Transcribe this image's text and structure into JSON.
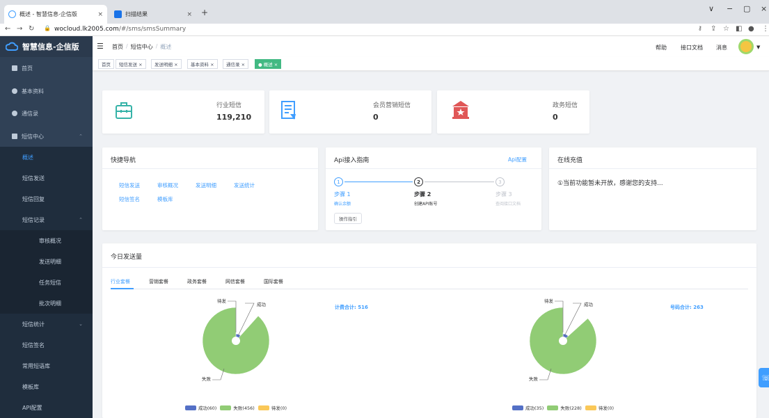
{
  "browser": {
    "tabs": [
      {
        "title": "概述 - 智慧信息-企信版",
        "close": "×"
      },
      {
        "title": "扫描结果",
        "close": "×"
      }
    ],
    "new_tab": "+",
    "url_host": "wocloud.lk2005.com",
    "url_path": "/#/sms/smsSummary",
    "window_controls": [
      "∨",
      "−",
      "▢",
      "×"
    ]
  },
  "brand": {
    "name": "智慧信息-企信版",
    "color": "#409eff"
  },
  "sidebar": {
    "items": [
      {
        "label": "首页",
        "icon": "grid-icon"
      },
      {
        "label": "基本资料",
        "icon": "user-icon"
      },
      {
        "label": "通信录",
        "icon": "contacts-icon"
      },
      {
        "label": "短信中心",
        "icon": "message-icon"
      },
      {
        "label": "概述"
      },
      {
        "label": "短信发送"
      },
      {
        "label": "短信回复"
      },
      {
        "label": "短信记录"
      },
      {
        "label": "审核概况"
      },
      {
        "label": "发送明细"
      },
      {
        "label": "任务短信"
      },
      {
        "label": "批次明细"
      },
      {
        "label": "短信统计"
      },
      {
        "label": "短信签名"
      },
      {
        "label": "常用短语库"
      },
      {
        "label": "模板库"
      },
      {
        "label": "API配置"
      }
    ]
  },
  "topbar": {
    "breadcrumb": [
      "首页",
      "短信中心",
      "概述"
    ],
    "sep": "/",
    "links": [
      "帮助",
      "接口文档",
      "消息"
    ]
  },
  "tags": [
    {
      "label": "首页"
    },
    {
      "label": "短信发送 ×"
    },
    {
      "label": "发送明细 ×"
    },
    {
      "label": "基本资料 ×"
    },
    {
      "label": "通信录 ×"
    },
    {
      "label": "● 概述 ×"
    }
  ],
  "stats": [
    {
      "label": "行业短信",
      "value": "119,210"
    },
    {
      "label": "会员营销短信",
      "value": "0"
    },
    {
      "label": "政务短信",
      "value": "0"
    }
  ],
  "quick_nav": {
    "title": "快捷导航",
    "links": [
      "短信发送",
      "审核概况",
      "发送明细",
      "发送统计",
      "短信签名",
      "模板库"
    ]
  },
  "api_guide": {
    "title": "Api接入指南",
    "config_link": "Api配置",
    "steps": [
      {
        "num": "1",
        "title": "步骤 1",
        "desc": "确认余额"
      },
      {
        "num": "2",
        "title": "步骤 2",
        "desc": "创建API账号"
      },
      {
        "num": "3",
        "title": "步骤 3",
        "desc": "查阅接口文档"
      }
    ],
    "button": "操作指引"
  },
  "recharge": {
    "title": "在线充值",
    "message": "①当前功能暂未开放，感谢您的支持..."
  },
  "today": {
    "title": "今日发送量",
    "tabs": [
      "行业套餐",
      "营销套餐",
      "政务套餐",
      "网信套餐",
      "国际套餐"
    ],
    "billing_total": "计费合计: 516",
    "number_total": "号码合计: 263",
    "labels": {
      "pending": "待发",
      "success": "成功",
      "fail": "失败"
    }
  },
  "chart_data": [
    {
      "type": "pie",
      "categories": [
        "成功",
        "失败",
        "待发"
      ],
      "values": [
        60,
        456,
        0
      ],
      "legend": [
        "成功(60)",
        "失败(456)",
        "待发(0)"
      ],
      "colors": [
        "#5470c6",
        "#91cc75",
        "#fac858"
      ]
    },
    {
      "type": "pie",
      "categories": [
        "成功",
        "失败",
        "待发"
      ],
      "values": [
        35,
        228,
        0
      ],
      "legend": [
        "成功(35)",
        "失败(228)",
        "待发(0)"
      ],
      "colors": [
        "#5470c6",
        "#91cc75",
        "#fac858"
      ]
    }
  ]
}
